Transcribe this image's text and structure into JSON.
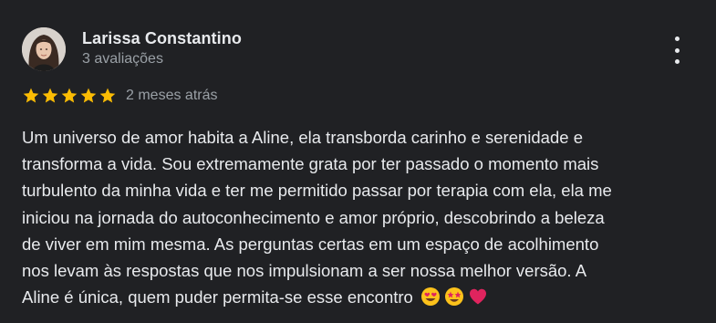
{
  "review": {
    "author_name": "Larissa Constantino",
    "author_reviews": "3 avaliações",
    "rating": 5,
    "rating_max": 5,
    "star_color": "#fbbc04",
    "date": "2 meses atrás",
    "text": "Um universo de amor habita a Aline, ela transborda carinho e serenidade e\ntransforma a vida. Sou extremamente grata por ter passado o momento mais\nturbulento da minha vida e ter me permitido passar por terapia com ela, ela me\niniciou na jornada do autoconhecimento e amor próprio, descobrindo a beleza\nde viver em mim mesma. As perguntas certas em um espaço de acolhimento\nnos levam às respostas que nos impulsionam a ser nossa melhor versão. A\nAline é única, quem puder permita-se esse encontro",
    "emojis": [
      "smiling-face-with-heart-eyes",
      "star-struck",
      "red-heart"
    ]
  },
  "menu_icon": "more-vert-icon"
}
